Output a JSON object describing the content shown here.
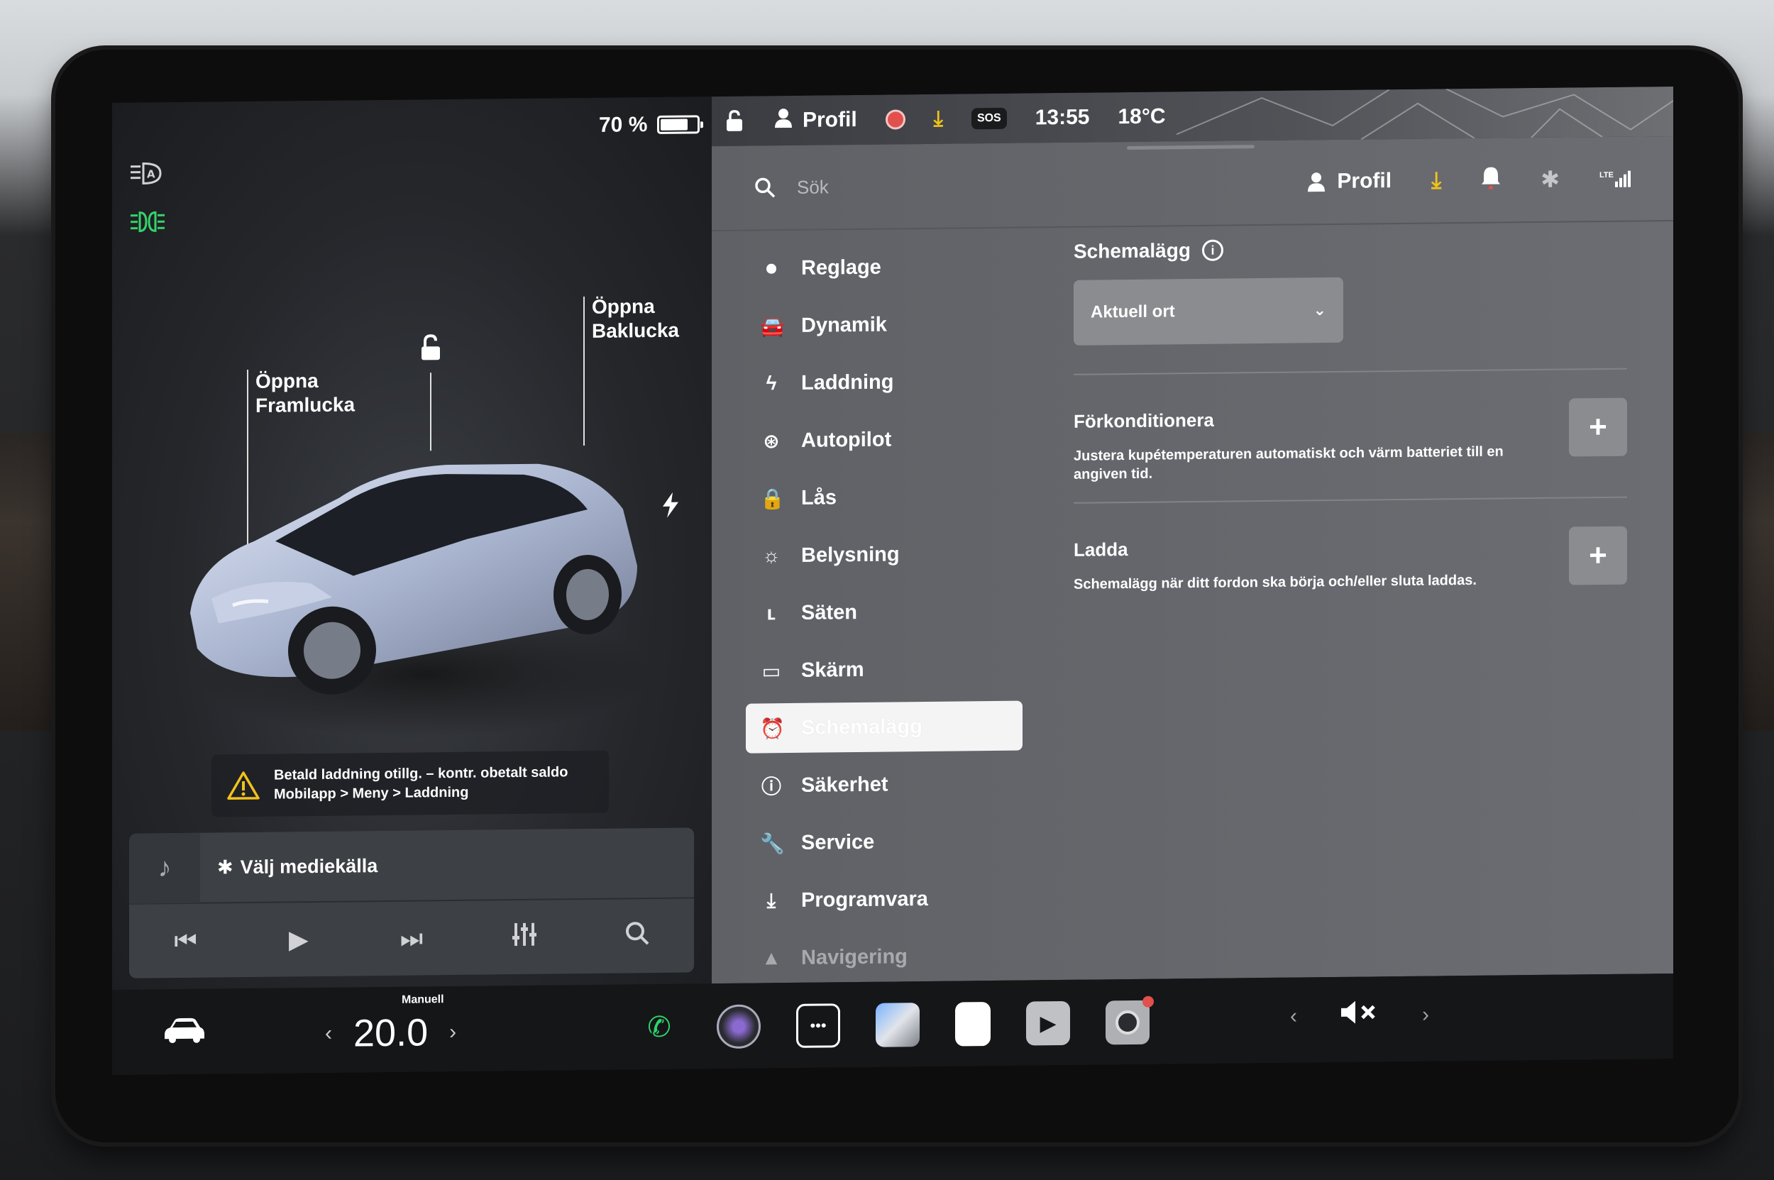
{
  "status": {
    "battery_percent": "70 %",
    "profile_label": "Profil",
    "sos_label": "SOS",
    "time": "13:55",
    "outside_temp": "18°C"
  },
  "car_panel": {
    "callout_frunk": [
      "Öppna",
      "Framlucka"
    ],
    "callout_trunk": [
      "Öppna",
      "Baklucka"
    ],
    "warning_line1": "Betald laddning otillg. – kontr. obetalt saldo",
    "warning_line2": "Mobilapp > Meny > Laddning"
  },
  "media": {
    "source_label": "Välj mediekälla",
    "controls": [
      "previous-icon",
      "play-icon",
      "next-icon",
      "equalizer-icon",
      "search-icon"
    ]
  },
  "settings_header": {
    "search_placeholder": "Sök",
    "profile_label": "Profil",
    "lte_label": "LTE"
  },
  "menu": {
    "items": [
      {
        "label": "Reglage",
        "icon": "toggle-icon"
      },
      {
        "label": "Dynamik",
        "icon": "car-icon"
      },
      {
        "label": "Laddning",
        "icon": "bolt-icon"
      },
      {
        "label": "Autopilot",
        "icon": "steering-wheel-icon"
      },
      {
        "label": "Lås",
        "icon": "lock-icon"
      },
      {
        "label": "Belysning",
        "icon": "sun-icon"
      },
      {
        "label": "Säten",
        "icon": "seat-icon"
      },
      {
        "label": "Skärm",
        "icon": "display-icon"
      },
      {
        "label": "Schemalägg",
        "icon": "alarm-clock-icon",
        "active": true
      },
      {
        "label": "Säkerhet",
        "icon": "alert-circle-icon"
      },
      {
        "label": "Service",
        "icon": "wrench-icon"
      },
      {
        "label": "Programvara",
        "icon": "download-icon"
      },
      {
        "label": "Navigering",
        "icon": "navigation-icon"
      }
    ]
  },
  "schedule": {
    "title": "Schemalägg",
    "location_selected": "Aktuell ort",
    "precondition_title": "Förkonditionera",
    "precondition_desc": "Justera kupétemperaturen automatiskt och värm batteriet till en angiven tid.",
    "charge_title": "Ladda",
    "charge_desc": "Schemalägg när ditt fordon ska börja och/eller sluta laddas.",
    "add_symbol": "+"
  },
  "dock": {
    "climate_mode": "Manuell",
    "temperature": "20.0",
    "apps": [
      "phone-icon",
      "camera-app-icon",
      "more-apps-icon",
      "navigation-app-icon",
      "calendar-icon",
      "theater-icon",
      "dashcam-icon"
    ]
  },
  "colors": {
    "accent_yellow": "#f2c21b",
    "record_red": "#e2504d",
    "lights_green": "#35d36a",
    "phone_green": "#2fd36b"
  }
}
